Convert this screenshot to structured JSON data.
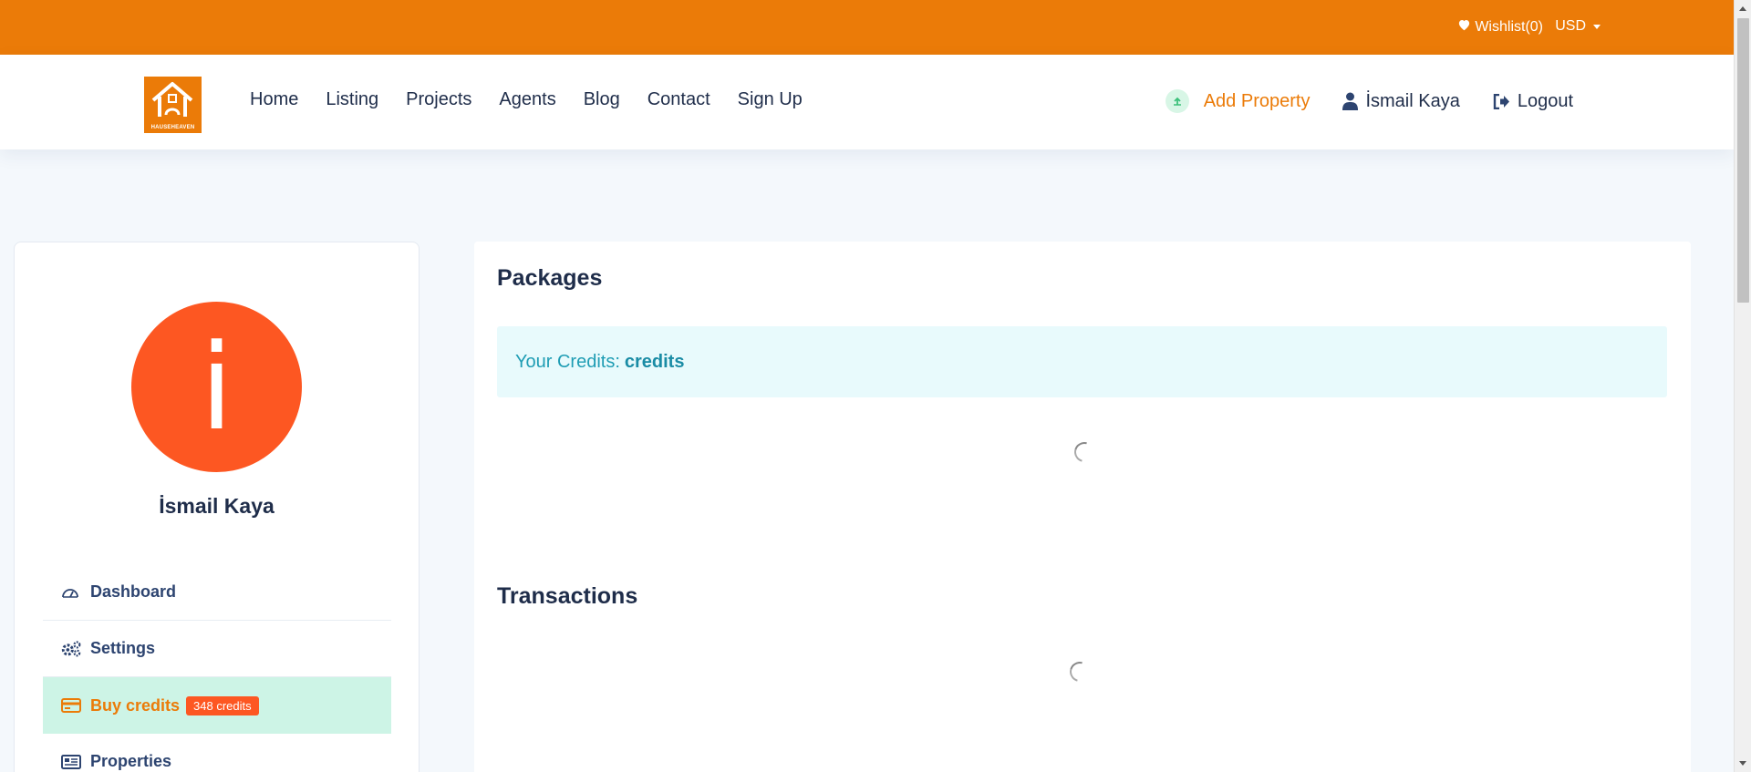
{
  "topbar": {
    "wishlist_label": "Wishlist(0)",
    "currency": "USD"
  },
  "header": {
    "logo_text": "HAUSEHEAVEN",
    "nav": [
      "Home",
      "Listing",
      "Projects",
      "Agents",
      "Blog",
      "Contact",
      "Sign Up"
    ],
    "add_property": "Add Property",
    "user_name": "İsmail Kaya",
    "logout": "Logout"
  },
  "sidebar": {
    "avatar_letter": "i",
    "user_name": "İsmail Kaya",
    "items": [
      {
        "label": "Dashboard",
        "icon": "dashboard-icon"
      },
      {
        "label": "Settings",
        "icon": "gears-icon"
      },
      {
        "label": "Buy credits",
        "icon": "credit-card-icon",
        "badge": "348 credits",
        "active": true
      },
      {
        "label": "Properties",
        "icon": "newspaper-icon"
      }
    ]
  },
  "main": {
    "packages_title": "Packages",
    "credits_label": "Your Credits:",
    "credits_value": "credits",
    "transactions_title": "Transactions"
  },
  "colors": {
    "accent": "#eb7b08",
    "avatar": "#fd5722",
    "active_menu_bg": "#cdf4e6",
    "alert_bg": "#e8fafc",
    "alert_text": "#1f9db4"
  }
}
